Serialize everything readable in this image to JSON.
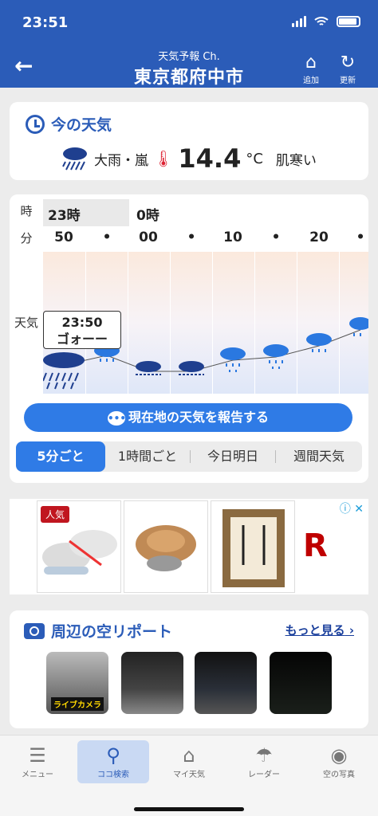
{
  "status": {
    "time": "23:51"
  },
  "header": {
    "subtitle": "天気予報 Ch.",
    "title": "東京都府中市",
    "add_label": "追加",
    "refresh_label": "更新"
  },
  "now": {
    "heading": "今の天気",
    "condition": "大雨・嵐",
    "temperature": "14.4",
    "unit": "°C",
    "feel": "肌寒い"
  },
  "forecast": {
    "row_labels": {
      "hour": "時",
      "minute": "分",
      "weather": "天気"
    },
    "hours": [
      "23時",
      "0時"
    ],
    "minutes": [
      "50",
      "•",
      "00",
      "•",
      "10",
      "•",
      "20",
      "•"
    ],
    "tooltip_time": "23:50",
    "tooltip_text": "ゴォーー",
    "report_button": "現在地の天気を報告する",
    "tabs": [
      "5分ごと",
      "1時間ごと",
      "今日明日",
      "週間天気"
    ],
    "active_tab": "5分ごと"
  },
  "ad": {
    "badge": "人気",
    "info_icons": "ⓘ ✕"
  },
  "photos": {
    "heading": "周辺の空リポート",
    "more": "もっと見る",
    "live_label": "ライブカメラ"
  },
  "tabbar": {
    "items": [
      {
        "label": "メニュー",
        "icon": "menu-icon"
      },
      {
        "label": "ココ検索",
        "icon": "search-icon"
      },
      {
        "label": "マイ天気",
        "icon": "home-icon"
      },
      {
        "label": "レーダー",
        "icon": "umbrella-icon"
      },
      {
        "label": "空の写真",
        "icon": "camera-icon"
      }
    ]
  },
  "colors": {
    "brand": "#2b5cb8",
    "accent": "#2f7be6"
  }
}
